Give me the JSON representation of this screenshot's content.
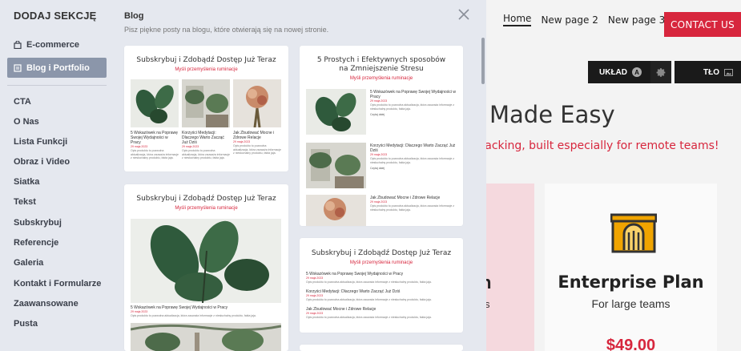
{
  "site": {
    "nav": [
      "Home",
      "New page 2",
      "New page 3"
    ],
    "contact_button": "CONTACT US",
    "layout_button": "UKŁAD",
    "layout_badge": "A",
    "background_button": "TŁO",
    "hero_title": "Made Easy",
    "hero_subtitle": "tracking, built especially for remote teams!",
    "left_plan_name_fragment": "n",
    "left_plan_sub_fragment": "s",
    "plan_name": "Enterprise Plan",
    "plan_subtitle": "For large teams",
    "plan_price": "$49.00",
    "accent_color": "#d7263d"
  },
  "sidebar": {
    "title": "DODAJ SEKCJĘ",
    "top_items": [
      {
        "label": "E-commerce",
        "icon": "bag-icon"
      },
      {
        "label": "Blog i Portfolio",
        "icon": "blog-icon",
        "active": true
      }
    ],
    "items": [
      "CTA",
      "O Nas",
      "Lista Funkcji",
      "Obraz i Video",
      "Siatka",
      "Tekst",
      "Subskrybuj",
      "Referencje",
      "Galeria",
      "Kontakt i Formularze",
      "Zaawansowane",
      "Pusta"
    ]
  },
  "panel": {
    "title": "Blog",
    "description": "Pisz piękne posty na blogu, które otwierają się na nowej stronie."
  },
  "templates": {
    "t1": {
      "title": "Subskrybuj i Zdobądź Dostęp Już Teraz",
      "subtitle": "Myśli przemyślenia ruminacje",
      "posts": [
        {
          "title": "5 Wskazówek na Poprawę Swojej Wydajności w Pracy",
          "date": "29 maja 2023",
          "body": "Opis produktu to pozwolna aktualizacja, która zauważa informacje z niesłuchalny produktu, fakta jaja."
        },
        {
          "title": "Korzyści Medytacji: Dlaczego Warto Zacząć Już Dziś",
          "date": "29 maja 2023",
          "body": "Opis produktu to pozwolna aktualizacja, która zauważa informacje z niesłuchalny produktu, fakta jaja."
        },
        {
          "title": "Jak Zbudować Mocne i Zdrowe Relacje",
          "date": "29 maja 2023",
          "body": "Opis produktu to pozwolna aktualizacja, która zauważa informacje z niesłuchalny produktu, fakta jaja."
        }
      ]
    },
    "t2": {
      "title": "5 Prostych i Efektywnych sposobów na Zmniejszenie Stresu",
      "subtitle": "Myśli przemyślenia ruminacje",
      "posts": [
        {
          "title": "5 Wskazówek na Poprawę Swojej Wydajności w Pracy",
          "date": "29 maja 2023",
          "body": "Opis produktu to pozwolna aktualizacja, która zauważa informacje z niesłuchalny produktu, fakta jaja.",
          "more": "Czytaj dalej"
        },
        {
          "title": "Korzyści Medytacji: Dlaczego Warto Zacząć Już Dziś",
          "date": "29 maja 2023",
          "body": "Opis produktu to pozwolna aktualizacja, która zauważa informacje z niesłuchalny produktu, fakta jaja.",
          "more": "Czytaj dalej"
        },
        {
          "title": "Jak Zbudować Mocne i Zdrowe Relacje",
          "date": "29 maja 2023",
          "body": "Opis produktu to pozwolna aktualizacja, która zauważa informacje z niesłuchalny produktu, fakta jaja."
        }
      ]
    },
    "t3": {
      "title": "Subskrybuj i Zdobądź Dostęp Już Teraz",
      "subtitle": "Myśli przemyślenia ruminacje",
      "posts": [
        {
          "title": "5 Wskazówek na Poprawę Swojej Wydajności w Pracy",
          "date": "29 maja 2023",
          "body": "Opis produktu to pozwolna aktualizacja, która zauważa informacje z niesłuchalny produktu, fakta jaja."
        }
      ]
    },
    "t4": {
      "title": "Subskrybuj i Zdobądź Dostęp Już Teraz",
      "subtitle": "Myśli przemyślenia ruminacje",
      "posts": [
        {
          "title": "5 Wskazówek na Poprawę Swojej Wydajności w Pracy",
          "date": "29 maja 2023",
          "body": "Opis produktu to pozwolna aktualizacja, która zauważa informacje z niesłuchalny produktu, fakta jaja."
        },
        {
          "title": "Korzyści Medytacji: Dlaczego Warto Zacząć Już Dziś",
          "date": "29 maja 2023",
          "body": "Opis produktu to pozwolna aktualizacja, która zauważa informacje z niesłuchalny produktu, fakta jaja."
        },
        {
          "title": "Jak Zbudować Mocne i Zdrowe Relacje",
          "date": "29 maja 2023",
          "body": "Opis produktu to pozwolna aktualizacja, która zauważa informacje z niesłuchalny produktu, fakta jaja."
        }
      ]
    }
  }
}
